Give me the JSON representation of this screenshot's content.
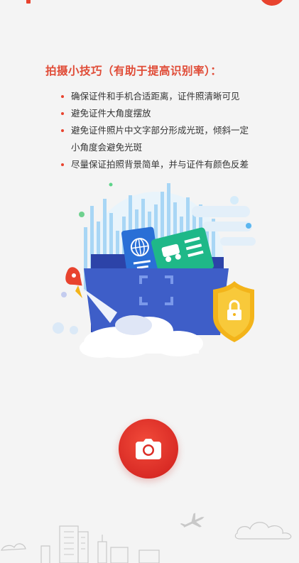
{
  "tips": {
    "title": "拍摄小技巧（有助于提高识别率）：",
    "items": [
      {
        "lines": [
          "确保证件和手机合适距离，证件照清晰可见"
        ]
      },
      {
        "lines": [
          "避免证件大角度摆放"
        ]
      },
      {
        "lines": [
          "避免证件照片中文字部分形成光斑，倾斜一定",
          "小角度会避免光斑"
        ]
      },
      {
        "lines": [
          "尽量保证拍照背景简单，并与证件有颜色反差"
        ]
      }
    ]
  },
  "colors": {
    "accent": "#e8432e",
    "title": "#e04b36",
    "folder_blue": "#3e5ec8",
    "shield_gold": "#f3b41a"
  },
  "icons": {
    "camera": "camera-icon",
    "settings": "gear-icon",
    "shield": "shield-lock-icon",
    "passport": "passport-icon",
    "vehicle_license": "vehicle-license-icon",
    "rocket": "rocket-icon",
    "airplane": "airplane-icon"
  }
}
